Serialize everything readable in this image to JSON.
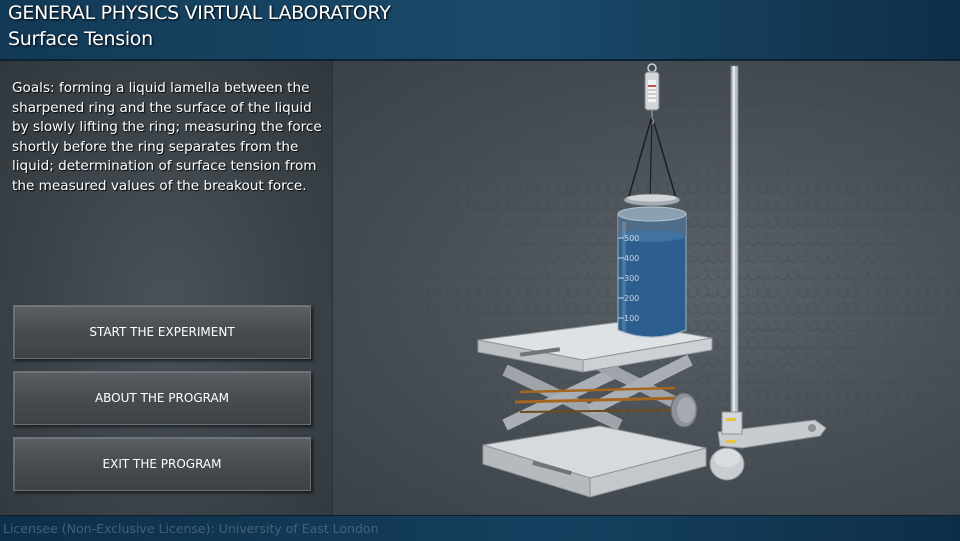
{
  "header": {
    "title": "GENERAL PHYSICS VIRTUAL LABORATORY",
    "subtitle": "Surface Tension"
  },
  "goals_text": "Goals: forming a liquid lamella between the sharpened ring and the surface of the liquid by slowly lifting the ring; measuring the force shortly before the ring separates from the liquid; determination of surface tension from the measured values of the breakout force.",
  "menu": {
    "start_label": "START THE EXPERIMENT",
    "about_label": "ABOUT THE PROGRAM",
    "exit_label": "EXIT THE PROGRAM"
  },
  "beaker_scale": [
    "500",
    "400",
    "300",
    "200",
    "100"
  ],
  "footer": {
    "license": "Licensee (Non-Exclusive License): University of East London"
  },
  "colors": {
    "header_blue": "#1a4a6a",
    "liquid_blue": "#2c5f8f",
    "lab_jack_gray": "#c8ccd0",
    "rod_orange": "#a5671f"
  }
}
